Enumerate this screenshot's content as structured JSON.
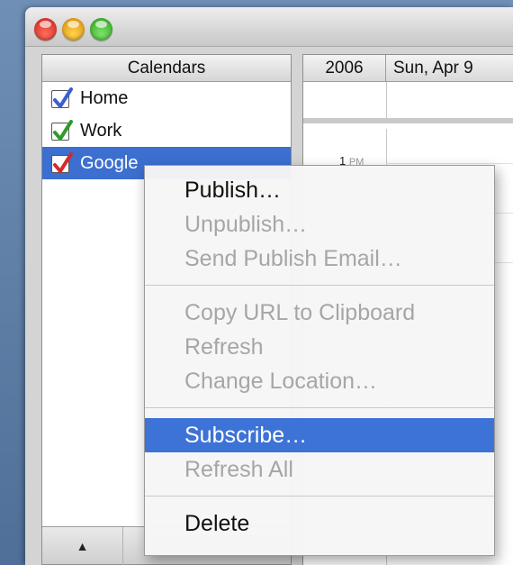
{
  "sidebar": {
    "header": "Calendars",
    "items": [
      {
        "label": "Home",
        "checked": true,
        "color": "#3a5fd0",
        "selected": false
      },
      {
        "label": "Work",
        "checked": true,
        "color": "#2e9a2a",
        "selected": false
      },
      {
        "label": "Google",
        "checked": true,
        "color": "#d42a2a",
        "selected": true
      }
    ],
    "footer_button_icon": "triangle-up-icon",
    "footer_button_glyph": "▲"
  },
  "main": {
    "year": "2006",
    "date": "Sun, Apr 9",
    "time_label_hour": "1",
    "time_label_suffix": "PM"
  },
  "context_menu": {
    "groups": [
      [
        {
          "label": "Publish…",
          "enabled": true
        },
        {
          "label": "Unpublish…",
          "enabled": false
        },
        {
          "label": "Send Publish Email…",
          "enabled": false
        }
      ],
      [
        {
          "label": "Copy URL to Clipboard",
          "enabled": false
        },
        {
          "label": "Refresh",
          "enabled": false
        },
        {
          "label": "Change Location…",
          "enabled": false
        }
      ],
      [
        {
          "label": "Subscribe…",
          "enabled": true,
          "highlighted": true
        },
        {
          "label": "Refresh All",
          "enabled": false
        }
      ],
      [
        {
          "label": "Delete",
          "enabled": true
        }
      ]
    ]
  },
  "colors": {
    "selection": "#3c6fd0",
    "menu_highlight": "#3d72d6",
    "disabled_text": "#a6a6a6"
  }
}
